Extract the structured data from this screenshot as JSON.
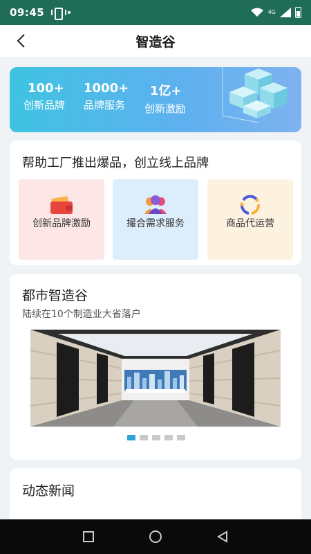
{
  "status_bar": {
    "time": "09:45",
    "network": "4G"
  },
  "header": {
    "title": "智造谷"
  },
  "banner": {
    "stats": [
      {
        "value": "100+",
        "label": "创新品牌"
      },
      {
        "value": "1000+",
        "label": "品牌服务"
      },
      {
        "value": "1亿+",
        "label": "创新激励"
      }
    ]
  },
  "help": {
    "title": "帮助工厂推出爆品，创立线上品牌",
    "tiles": [
      {
        "label": "创新品牌激励",
        "icon": "wallet-icon"
      },
      {
        "label": "撮合需求服务",
        "icon": "people-icon"
      },
      {
        "label": "商品代运营",
        "icon": "cycle-icon"
      }
    ]
  },
  "city": {
    "title": "都市智造谷",
    "subtitle": "陆续在10个制造业大省落户",
    "carousel": {
      "slides": 5,
      "active": 1
    }
  },
  "news": {
    "title": "动态新闻"
  },
  "colors": {
    "status_bar": "#1f6d57",
    "banner_start": "#3ec3e2",
    "banner_end": "#7eb2ef",
    "dot_active": "#2ea3d8"
  }
}
